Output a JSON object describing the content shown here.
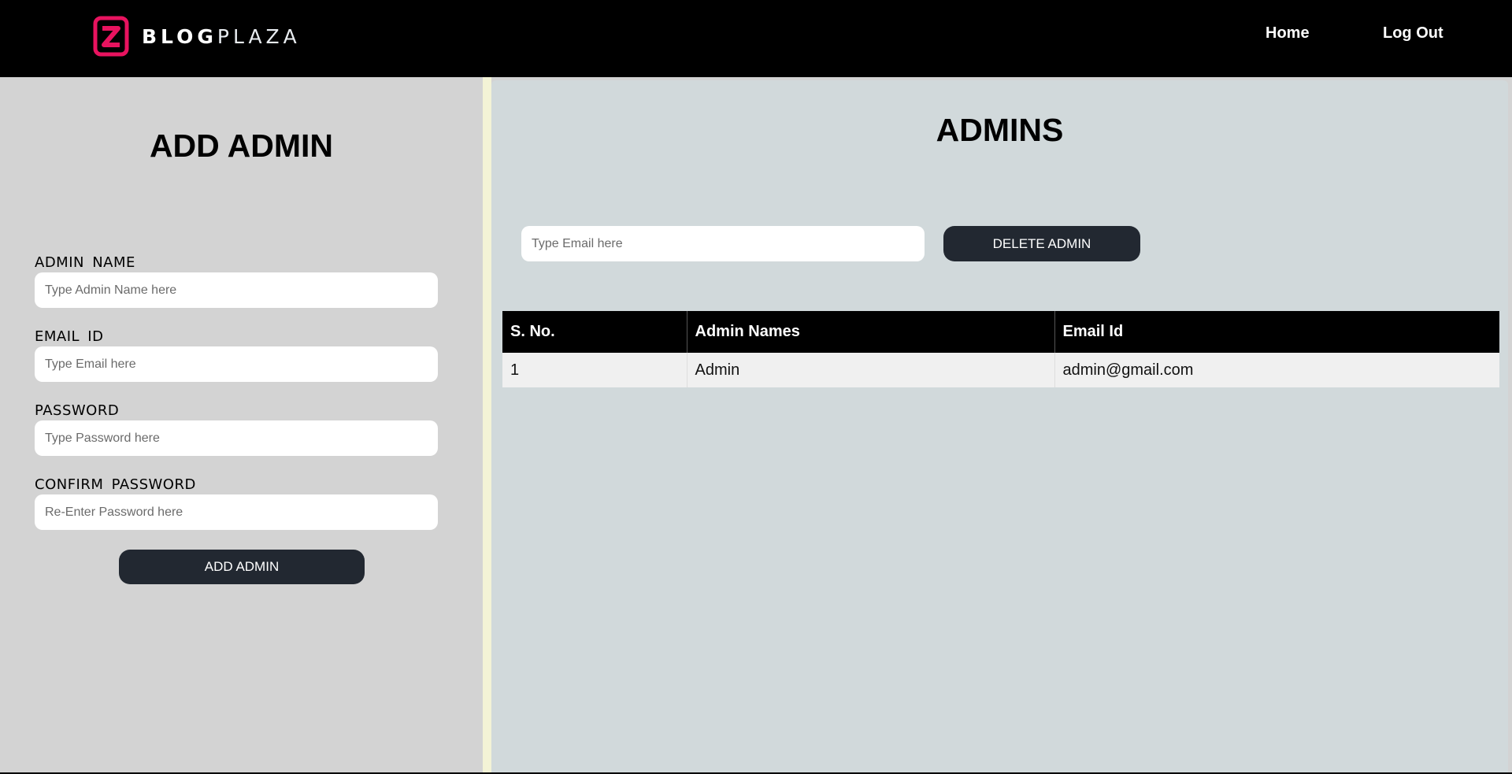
{
  "header": {
    "brand_bold": "BLOG",
    "brand_light": "PLAZA",
    "nav": {
      "home": "Home",
      "logout": "Log Out"
    },
    "logo_color": "#e8135f"
  },
  "add_admin": {
    "title": "ADD ADMIN",
    "fields": [
      {
        "label": "ADMIN NAME",
        "placeholder": "Type Admin Name here",
        "value": ""
      },
      {
        "label": "EMAIL ID",
        "placeholder": "Type Email here",
        "value": ""
      },
      {
        "label": "PASSWORD",
        "placeholder": "Type Password here",
        "value": ""
      },
      {
        "label": "CONFIRM PASSWORD",
        "placeholder": "Re-Enter Password here",
        "value": ""
      }
    ],
    "submit_label": "ADD ADMIN"
  },
  "admins": {
    "title": "ADMINS",
    "delete_placeholder": "Type Email here",
    "delete_label": "DELETE ADMIN",
    "table": {
      "headers": [
        "S. No.",
        "Admin Names",
        "Email Id"
      ],
      "rows": [
        [
          "1",
          "Admin",
          "admin@gmail.com"
        ]
      ]
    }
  },
  "colors": {
    "header_bg": "#000000",
    "left_panel_bg": "#d3d3d3",
    "right_panel_bg": "#d1d9db",
    "button_bg": "#222831",
    "divider": "#f3f3d6"
  }
}
